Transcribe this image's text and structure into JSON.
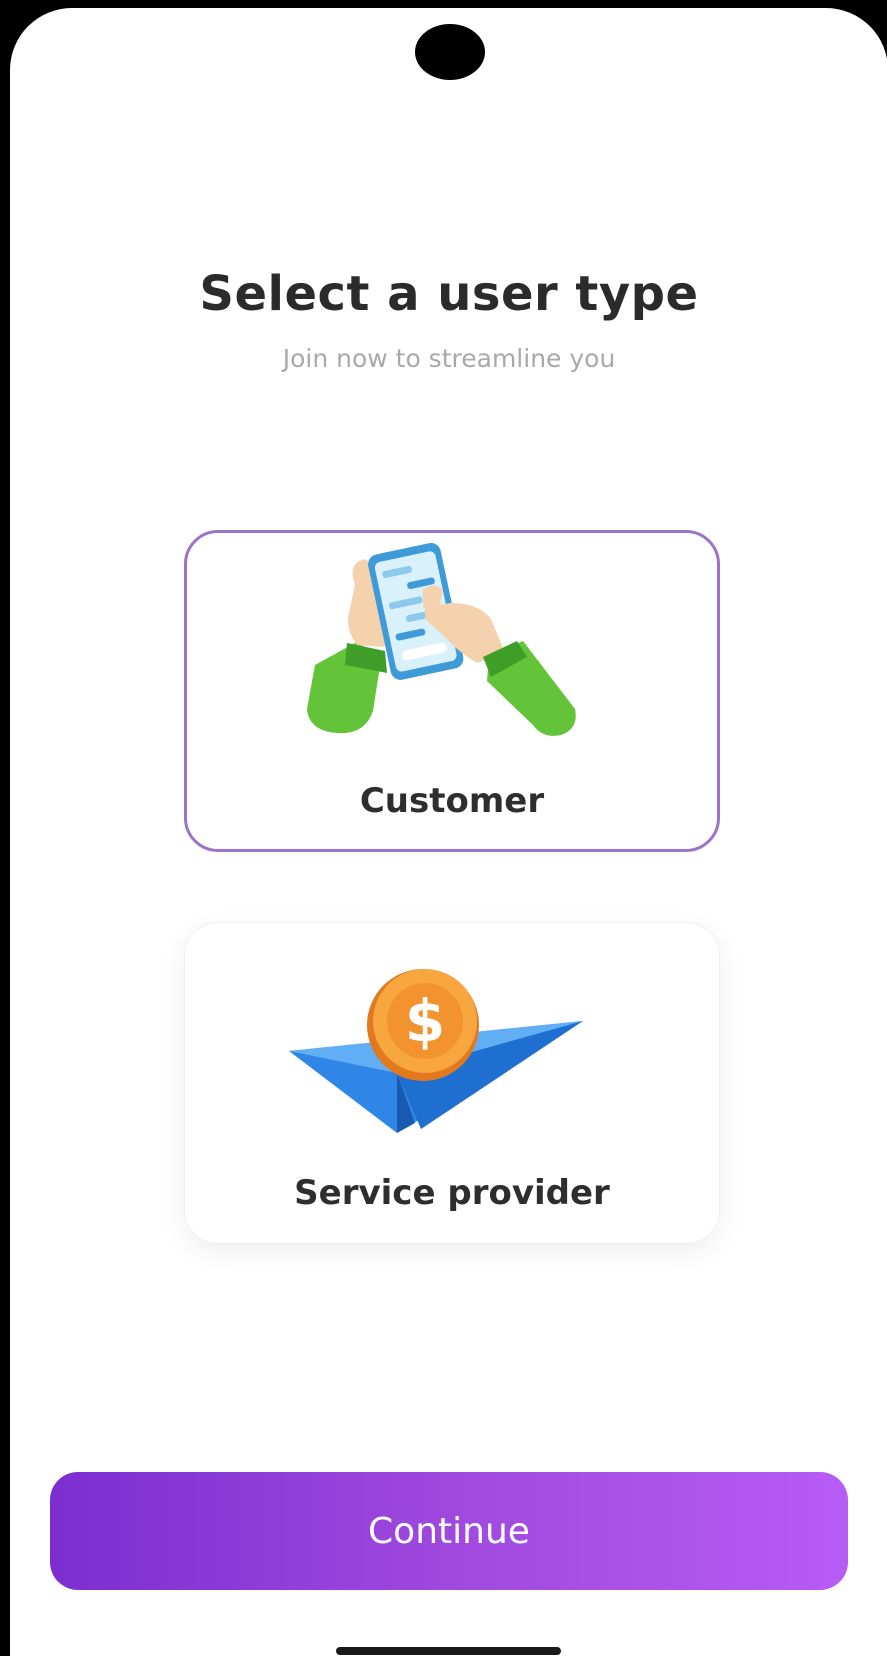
{
  "header": {
    "title": "Select a user type",
    "subtitle": "Join now to streamline you"
  },
  "user_types": [
    {
      "label": "Customer",
      "illustration": "hands-holding-phone-icon",
      "selected": true
    },
    {
      "label": "Service provider",
      "illustration": "paper-plane-coin-icon",
      "selected": false
    }
  ],
  "actions": {
    "continue_label": "Continue"
  },
  "colors": {
    "selected_border": "#9b73c8",
    "button_gradient_start": "#7d2ed0",
    "button_gradient_end": "#b75cf5",
    "title": "#2b2b2b",
    "subtitle": "#a9a9a9"
  }
}
